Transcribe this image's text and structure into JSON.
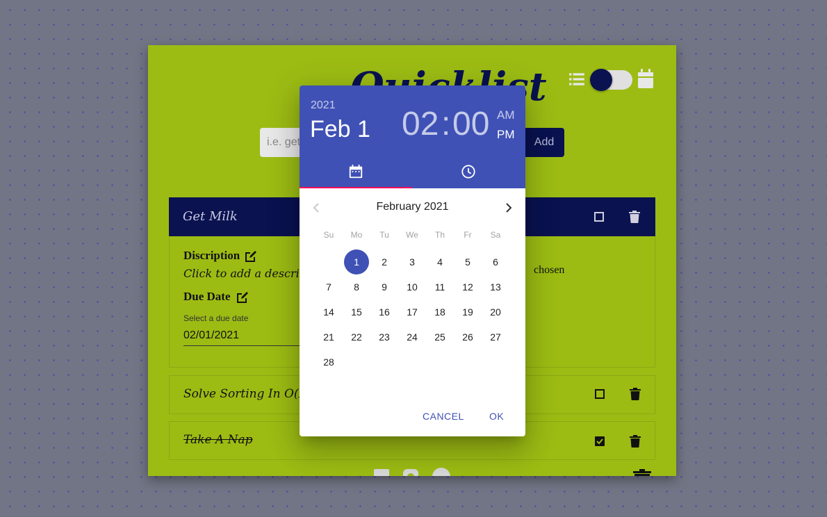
{
  "app": {
    "title": "Quicklist",
    "input_placeholder": "i.e. get milk",
    "add_label": "Add"
  },
  "expanded_task": {
    "name": "Get Milk",
    "description_heading": "Discription",
    "description_text": "Click to add a description",
    "due_date_heading": "Due Date",
    "due_date_label": "Select a due date",
    "due_date_value": "02/01/2021",
    "chosen_text": "chosen"
  },
  "tasks": [
    {
      "name": "Solve Sorting In O(N)",
      "checked": false
    },
    {
      "name": "Take A Nap",
      "checked": true
    }
  ],
  "picker": {
    "year": "2021",
    "date": "Feb 1",
    "hour": "02",
    "colon": ":",
    "minute": "00",
    "am": "AM",
    "pm": "PM",
    "month_label": "February 2021",
    "weekdays": [
      "Su",
      "Mo",
      "Tu",
      "We",
      "Th",
      "Fr",
      "Sa"
    ],
    "first_weekday_offset": 1,
    "days": [
      "1",
      "2",
      "3",
      "4",
      "5",
      "6",
      "7",
      "8",
      "9",
      "10",
      "11",
      "12",
      "13",
      "14",
      "15",
      "16",
      "17",
      "18",
      "19",
      "20",
      "21",
      "22",
      "23",
      "24",
      "25",
      "26",
      "27",
      "28"
    ],
    "selected_day": "1",
    "cancel_label": "CANCEL",
    "ok_label": "OK"
  },
  "colors": {
    "accent": "#3f51b5",
    "tab_indicator": "#f50057",
    "app_bg": "#9cbc14",
    "navy": "#0a1250"
  }
}
